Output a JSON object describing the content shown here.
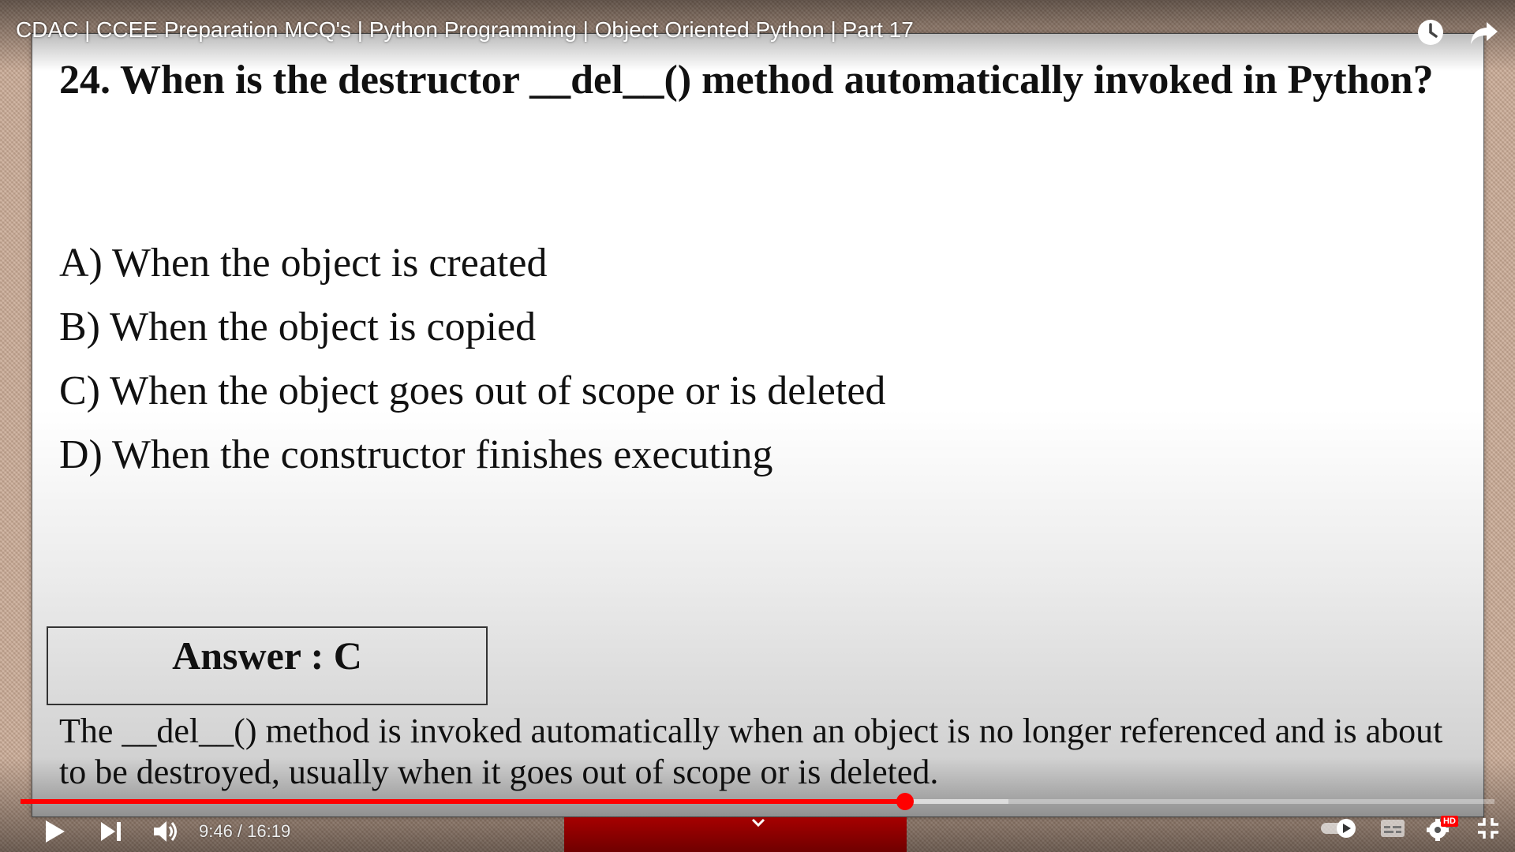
{
  "video": {
    "title": "CDAC | CCEE Preparation MCQ's | Python Programming | Object Oriented Python | Part 17",
    "current_time": "9:46",
    "duration": "16:19",
    "time_display": "9:46 / 16:19",
    "played_fraction": 0.6,
    "buffered_fraction": 0.67,
    "quality_badge": "HD",
    "progress_color": "#ff0000"
  },
  "slide": {
    "question": "24. When is the destructor __del__() method automatically invoked in Python?",
    "options": [
      "A) When the object is created",
      "B) When the object is copied",
      "C) When the object goes out of scope or is deleted",
      "D) When the constructor finishes executing"
    ],
    "answer_label": "Answer : C",
    "explanation": "The __del__() method is invoked automatically when an object is no longer referenced and is about to be destroyed, usually when it goes out of scope or is deleted."
  },
  "icons": {
    "top": [
      "watch-later-icon",
      "share-icon"
    ],
    "bottom_left": [
      "play-icon",
      "next-icon",
      "volume-icon"
    ],
    "bottom_right": [
      "autoplay-toggle-icon",
      "subtitles-icon",
      "settings-icon",
      "exit-fullscreen-icon"
    ]
  }
}
